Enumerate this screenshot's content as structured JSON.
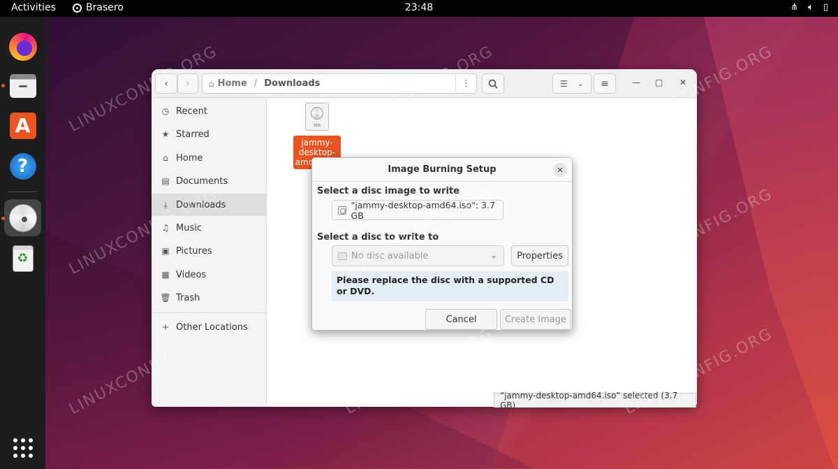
{
  "topbar": {
    "activities": "Activities",
    "app_name": "Brasero",
    "clock": "23:48",
    "tray_icons": [
      "network-icon",
      "volume-icon",
      "battery-icon"
    ]
  },
  "dock": {
    "items": [
      "Firefox",
      "Files",
      "Ubuntu Software",
      "Help",
      "Brasero",
      "Rubbish Bin"
    ],
    "show_apps_icon": "grid-icon"
  },
  "files": {
    "path": {
      "home": "Home",
      "current": "Downloads"
    },
    "sidebar": [
      {
        "label": "Recent",
        "icon": "clock-icon"
      },
      {
        "label": "Starred",
        "icon": "star-icon"
      },
      {
        "label": "Home",
        "icon": "home-icon"
      },
      {
        "label": "Documents",
        "icon": "document-icon"
      },
      {
        "label": "Downloads",
        "icon": "download-icon",
        "selected": true
      },
      {
        "label": "Music",
        "icon": "music-icon"
      },
      {
        "label": "Pictures",
        "icon": "picture-icon"
      },
      {
        "label": "Videos",
        "icon": "video-icon"
      },
      {
        "label": "Trash",
        "icon": "trash-icon"
      },
      {
        "label": "Other Locations",
        "icon": "plus-icon"
      }
    ],
    "file": {
      "name": "jammy-desktop-amd64.iso",
      "visible_label": "jammy-\ndesktop-\namd64.iso",
      "icon_tag": "iso"
    },
    "status": "“jammy-desktop-amd64.iso” selected  (3.7 GB)"
  },
  "dialog": {
    "title": "Image Burning Setup",
    "image_label": "Select a disc image to write",
    "image_value": "\"jammy-desktop-amd64.iso\": 3.7 GB",
    "disc_label": "Select a disc to write to",
    "disc_select": "No disc available",
    "properties_button": "Properties",
    "info": "Please replace the disc with a supported CD or DVD.",
    "cancel_button": "Cancel",
    "create_button": "Create Image"
  },
  "watermark": "LINUXCONFIG.ORG",
  "colors": {
    "accent": "#e95420",
    "topbar": "#000000",
    "dock": "#1d1d1d",
    "info_bg": "#e3eef5"
  }
}
